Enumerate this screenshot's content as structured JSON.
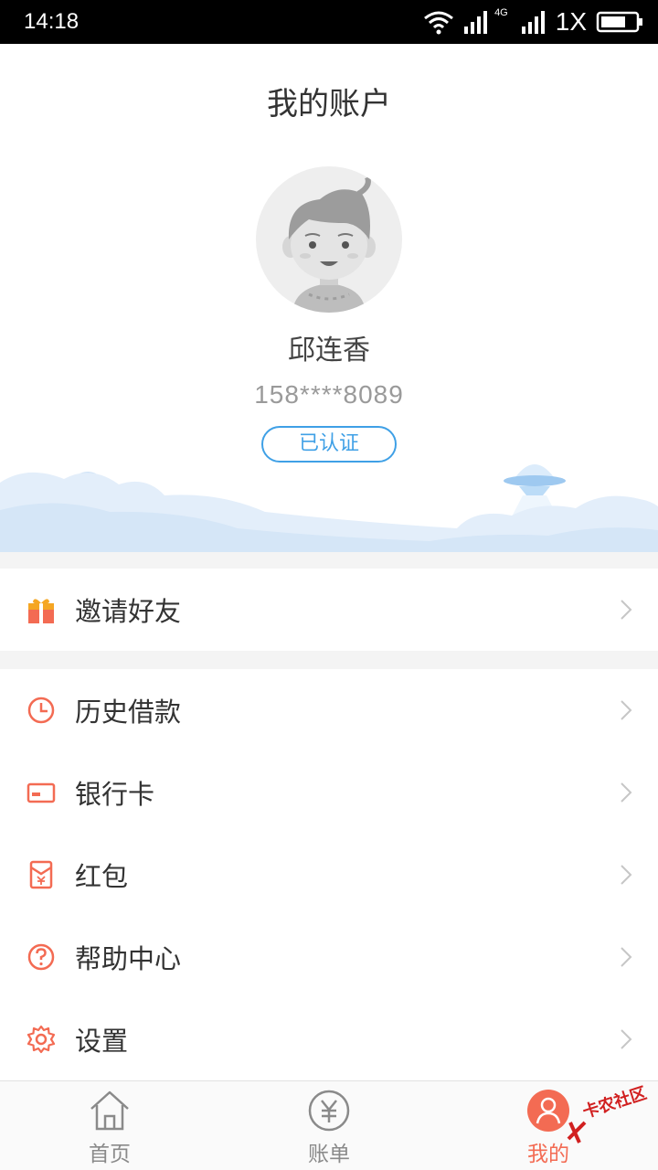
{
  "status_bar": {
    "time": "14:18",
    "network": "4G",
    "carrier": "1X"
  },
  "header": {
    "title": "我的账户"
  },
  "profile": {
    "name": "邱连香",
    "phone": "158****8089",
    "verified_label": "已认证"
  },
  "menu": {
    "invite": {
      "label": "邀请好友",
      "icon": "gift-icon"
    },
    "items": [
      {
        "label": "历史借款",
        "icon": "clock-icon"
      },
      {
        "label": "银行卡",
        "icon": "bank-card-icon"
      },
      {
        "label": "红包",
        "icon": "red-envelope-icon"
      },
      {
        "label": "帮助中心",
        "icon": "help-icon"
      },
      {
        "label": "设置",
        "icon": "settings-gear-icon"
      }
    ]
  },
  "tabbar": {
    "tabs": [
      {
        "label": "首页",
        "icon": "home-icon",
        "active": false
      },
      {
        "label": "账单",
        "icon": "bill-yuan-icon",
        "active": false
      },
      {
        "label": "我的",
        "icon": "user-icon",
        "active": true
      }
    ]
  },
  "watermark": {
    "text": "卡农社区"
  },
  "colors": {
    "accent": "#f36b53",
    "verified_blue": "#3fa0e6",
    "gift_orange": "#f5a623"
  }
}
